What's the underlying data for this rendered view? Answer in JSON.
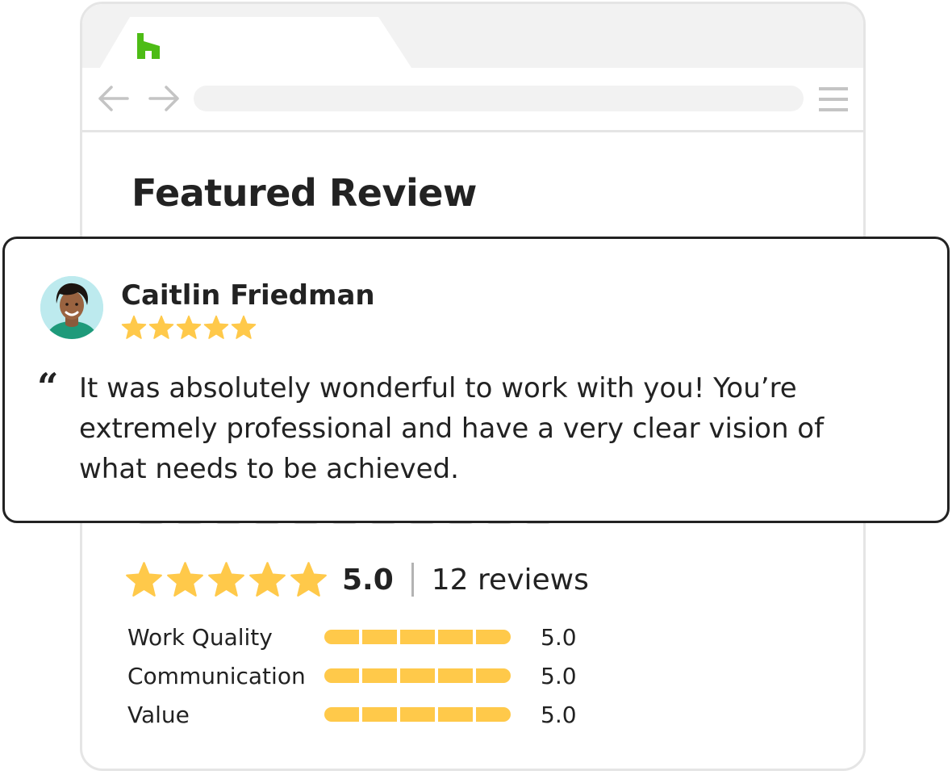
{
  "browser": {
    "logo_icon": "houzz-logo-icon",
    "brand_color": "#4dbc15",
    "nav": {
      "back_icon": "arrow-left-icon",
      "forward_icon": "arrow-right-icon",
      "menu_icon": "hamburger-menu-icon"
    }
  },
  "page": {
    "title": "Featured Review"
  },
  "featured_review": {
    "reviewer_name": "Caitlin Friedman",
    "rating": 5,
    "quote_mark": "“",
    "text": "It was absolutely wonderful to work with you! You’re extremely professional and have a very clear vision of what needs to be achieved."
  },
  "summary": {
    "stars": 5,
    "score": "5.0",
    "count": "12 reviews"
  },
  "ratings": [
    {
      "label": "Work Quality",
      "value": "5.0",
      "fill": 1.0
    },
    {
      "label": "Communication",
      "value": "5.0",
      "fill": 1.0
    },
    {
      "label": "Value",
      "value": "5.0",
      "fill": 1.0
    }
  ],
  "colors": {
    "star": "#ffc94a",
    "text": "#222222",
    "border": "#e5e5e5"
  }
}
